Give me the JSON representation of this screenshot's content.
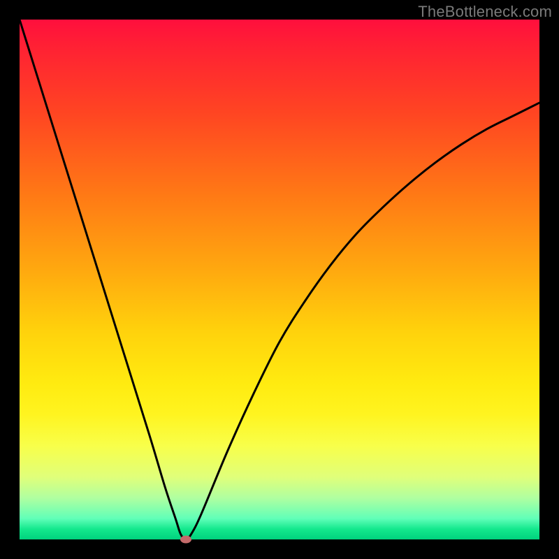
{
  "watermark": "TheBottleneck.com",
  "colors": {
    "bg": "#000000",
    "curve": "#000000",
    "dot": "#c56b6b"
  },
  "chart_data": {
    "type": "line",
    "title": "",
    "xlabel": "",
    "ylabel": "",
    "xlim": [
      0,
      100
    ],
    "ylim": [
      0,
      100
    ],
    "grid": false,
    "legend": false,
    "series": [
      {
        "name": "bottleneck-curve",
        "x": [
          0,
          5,
          10,
          15,
          20,
          25,
          28,
          30,
          31,
          32,
          33,
          35,
          40,
          45,
          50,
          55,
          60,
          65,
          70,
          75,
          80,
          85,
          90,
          95,
          100
        ],
        "y": [
          100,
          84,
          68,
          52,
          36,
          20,
          10,
          4,
          1,
          0,
          1,
          5,
          17,
          28,
          38,
          46,
          53,
          59,
          64,
          68.5,
          72.5,
          76,
          79,
          81.5,
          84
        ]
      }
    ],
    "marker": {
      "x": 32,
      "y": 0
    },
    "gradient_stops": [
      {
        "pos": 0,
        "color": "#ff0f3d"
      },
      {
        "pos": 5,
        "color": "#ff2034"
      },
      {
        "pos": 18,
        "color": "#ff4522"
      },
      {
        "pos": 34,
        "color": "#ff7a15"
      },
      {
        "pos": 48,
        "color": "#ffa80f"
      },
      {
        "pos": 60,
        "color": "#ffd20c"
      },
      {
        "pos": 70,
        "color": "#ffeb10"
      },
      {
        "pos": 76,
        "color": "#fff420"
      },
      {
        "pos": 82,
        "color": "#f8ff4a"
      },
      {
        "pos": 88,
        "color": "#e0ff7a"
      },
      {
        "pos": 92,
        "color": "#b0ffa0"
      },
      {
        "pos": 96,
        "color": "#60ffb8"
      },
      {
        "pos": 98,
        "color": "#14e88d"
      },
      {
        "pos": 100,
        "color": "#00d27e"
      }
    ]
  }
}
